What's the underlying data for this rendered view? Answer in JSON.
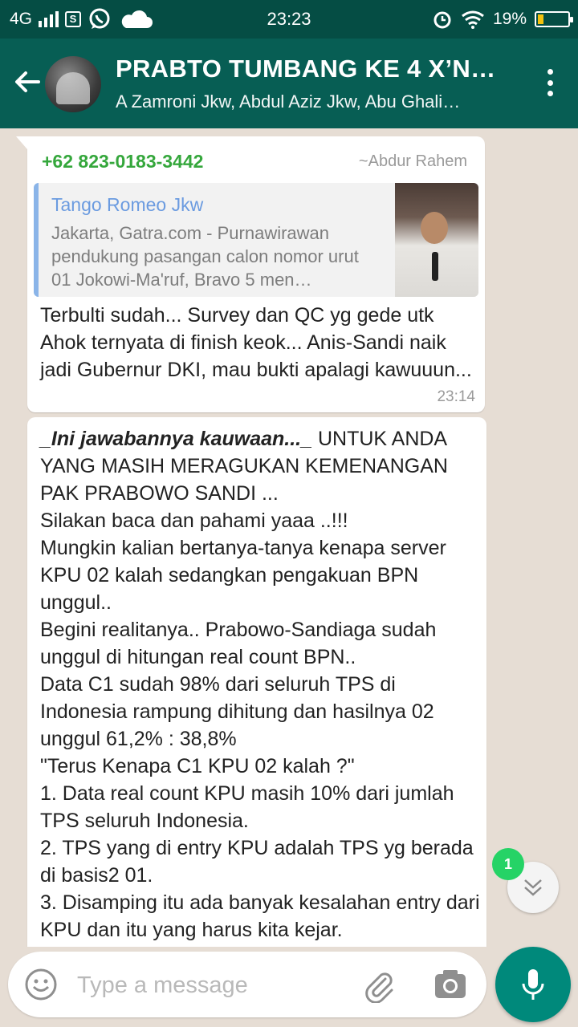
{
  "status_bar": {
    "network": "4G",
    "time": "23:23",
    "battery": "19%",
    "battery_level": 0.19,
    "icons": [
      "signal-icon",
      "sim-icon",
      "whatsapp-icon",
      "cloud-icon",
      "alarm-icon",
      "wifi-icon",
      "battery-icon"
    ]
  },
  "header": {
    "title": "PRABTO TUMBANG KE 4 X’N…",
    "subtitle": "A Zamroni Jkw, Abdul Aziz Jkw, Abu Ghali…"
  },
  "messages": [
    {
      "sender_phone": "+62 823-0183-3442",
      "sender_name": "~Abdur Rahem",
      "quoted": {
        "author": "Tango Romeo Jkw",
        "text": "Jakarta, Gatra.com - Purnawirawan pendukung pasangan calon nomor urut 01 Jokowi-Ma'ruf, Bravo 5 men…"
      },
      "text": "Terbulti sudah... Survey dan QC yg gede utk Ahok ternyata di finish keok... Anis-Sandi naik jadi Gubernur DKI, mau bukti apalagi kawuuun...",
      "time": "23:14"
    },
    {
      "text_emph": "_Ini jawabannya kauwaan..._",
      "text": " UNTUK ANDA YANG MASIH MERAGUKAN KEMENANGAN PAK PRABOWO SANDI ...\nSilakan baca dan pahami yaaa ..!!!\nMungkin kalian bertanya-tanya kenapa server KPU 02 kalah sedangkan pengakuan BPN unggul..\nBegini realitanya.. Prabowo-Sandiaga sudah unggul di hitungan real count BPN..\nData C1 sudah 98% dari seluruh TPS di Indonesia rampung dihitung dan hasilnya 02 unggul 61,2% : 38,8%\n\"Terus Kenapa C1 KPU 02 kalah ?\"\n1. Data real count KPU masih 10% dari jumlah TPS seluruh Indonesia.\n2. TPS yang di entry KPU adalah TPS yg berada di basis2 01.\n3. Disamping itu ada banyak kesalahan entry dari KPU dan itu yang harus kita kejar."
    }
  ],
  "unread_count": "1",
  "input": {
    "placeholder": "Type a message"
  },
  "colors": {
    "header": "#075e54",
    "status_bar": "#054d44",
    "sender_phone": "#35a73c",
    "quote_author": "#6b9be0",
    "mic_button": "#00897b",
    "unread_badge": "#25d366"
  }
}
